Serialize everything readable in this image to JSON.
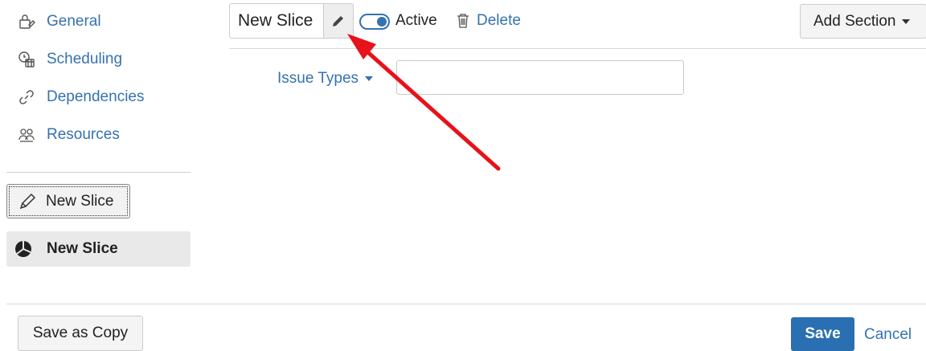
{
  "sidebar": {
    "items": [
      {
        "label": "General",
        "icon": "general-settings-icon"
      },
      {
        "label": "Scheduling",
        "icon": "calendar-clock-icon"
      },
      {
        "label": "Dependencies",
        "icon": "link-icon"
      },
      {
        "label": "Resources",
        "icon": "people-icon"
      }
    ],
    "new_slice_button": "New Slice",
    "selected_slice": "New Slice"
  },
  "header": {
    "slice_name": "New Slice",
    "toggle_label": "Active",
    "toggle_on": true,
    "delete_label": "Delete",
    "add_section_label": "Add Section"
  },
  "main": {
    "issue_types_label": "Issue Types",
    "issue_types_value": ""
  },
  "footer": {
    "save_copy_label": "Save as Copy",
    "save_label": "Save",
    "cancel_label": "Cancel"
  },
  "colors": {
    "link": "#3572b0",
    "primary_button": "#2a6fb2",
    "annotation_arrow": "#e8121a"
  }
}
